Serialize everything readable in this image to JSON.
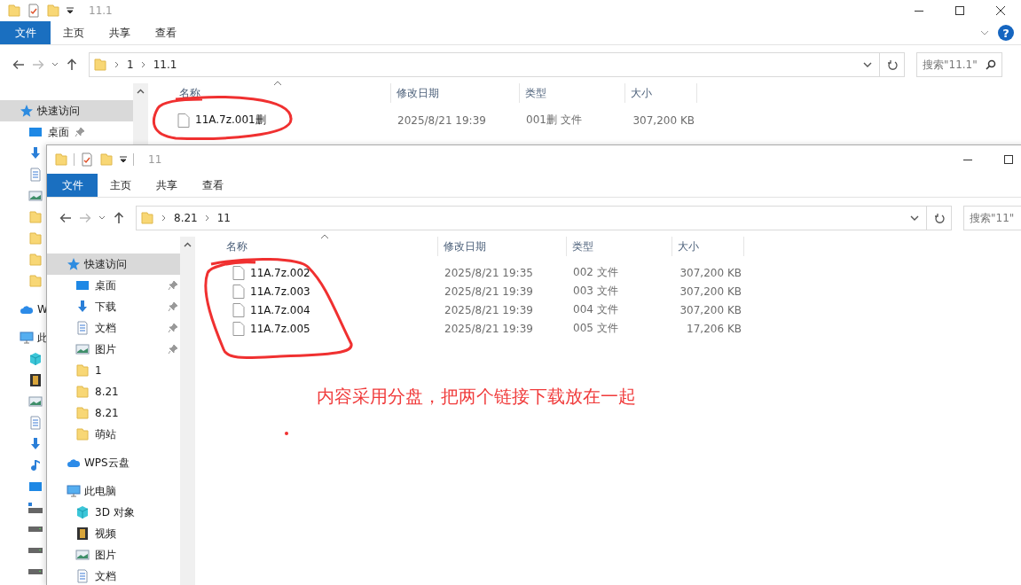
{
  "windows": [
    {
      "title": "11.1",
      "help": "?",
      "ribbon_tabs": [
        {
          "label": "文件",
          "selected": true
        },
        {
          "label": "主页",
          "selected": false
        },
        {
          "label": "共享",
          "selected": false
        },
        {
          "label": "查看",
          "selected": false
        }
      ],
      "breadcrumb": [
        "1",
        "11.1"
      ],
      "search": {
        "placeholder": "搜索\"11.1\""
      },
      "sidebar": [
        {
          "label": "快速访问",
          "kind": "star",
          "selected": true,
          "children": [
            {
              "label": "桌面",
              "kind": "desktop",
              "pinned": true
            },
            {
              "kind": "download"
            },
            {
              "kind": "document"
            },
            {
              "kind": "picture"
            },
            {
              "kind": "folder"
            },
            {
              "kind": "folder"
            },
            {
              "kind": "folder"
            },
            {
              "kind": "folder"
            }
          ]
        },
        {
          "label": "W",
          "kind": "cloud",
          "selected": false
        },
        {
          "label": "此",
          "kind": "computer",
          "selected": false,
          "children": [
            {
              "kind": "cube"
            },
            {
              "kind": "film"
            },
            {
              "kind": "picture"
            },
            {
              "kind": "document"
            },
            {
              "kind": "download"
            },
            {
              "kind": "music"
            },
            {
              "kind": "desktop"
            },
            {
              "kind": "netdrive"
            },
            {
              "kind": "drive"
            },
            {
              "kind": "drive"
            },
            {
              "kind": "drive"
            }
          ]
        }
      ],
      "columns": [
        "名称",
        "修改日期",
        "类型",
        "大小"
      ],
      "files": [
        {
          "name": "11A.7z.001删",
          "date": "2025/8/21 19:39",
          "type": "001删 文件",
          "size": "307,200 KB"
        }
      ]
    },
    {
      "title": "11",
      "ribbon_tabs": [
        {
          "label": "文件",
          "selected": true
        },
        {
          "label": "主页",
          "selected": false
        },
        {
          "label": "共享",
          "selected": false
        },
        {
          "label": "查看",
          "selected": false
        }
      ],
      "breadcrumb": [
        "8.21",
        "11"
      ],
      "search": {
        "placeholder": "搜索\"11\""
      },
      "sidebar": [
        {
          "label": "快速访问",
          "kind": "star",
          "selected": true,
          "children": [
            {
              "label": "桌面",
              "kind": "desktop",
              "pinned": true
            },
            {
              "label": "下载",
              "kind": "download",
              "pinned": true
            },
            {
              "label": "文档",
              "kind": "document",
              "pinned": true
            },
            {
              "label": "图片",
              "kind": "picture",
              "pinned": true
            },
            {
              "label": "1",
              "kind": "folder",
              "pinned": false
            },
            {
              "label": "8.21",
              "kind": "folder",
              "pinned": false
            },
            {
              "label": "8.21",
              "kind": "folder",
              "pinned": false
            },
            {
              "label": "萌站",
              "kind": "folder",
              "pinned": false
            }
          ]
        },
        {
          "label": "WPS云盘",
          "kind": "cloud",
          "selected": false
        },
        {
          "label": "此电脑",
          "kind": "computer",
          "selected": false,
          "children": [
            {
              "label": "3D 对象",
              "kind": "cube"
            },
            {
              "label": "视频",
              "kind": "film"
            },
            {
              "label": "图片",
              "kind": "picture"
            },
            {
              "label": "文档",
              "kind": "document"
            }
          ]
        }
      ],
      "columns": [
        "名称",
        "修改日期",
        "类型",
        "大小"
      ],
      "files": [
        {
          "name": "11A.7z.002",
          "date": "2025/8/21 19:35",
          "type": "002 文件",
          "size": "307,200 KB"
        },
        {
          "name": "11A.7z.003",
          "date": "2025/8/21 19:39",
          "type": "003 文件",
          "size": "307,200 KB"
        },
        {
          "name": "11A.7z.004",
          "date": "2025/8/21 19:39",
          "type": "004 文件",
          "size": "307,200 KB"
        },
        {
          "name": "11A.7z.005",
          "date": "2025/8/21 19:39",
          "type": "005 文件",
          "size": "17,206 KB"
        }
      ]
    }
  ],
  "annotation": {
    "note": "内容采用分盘，把两个链接下载放在一起"
  }
}
